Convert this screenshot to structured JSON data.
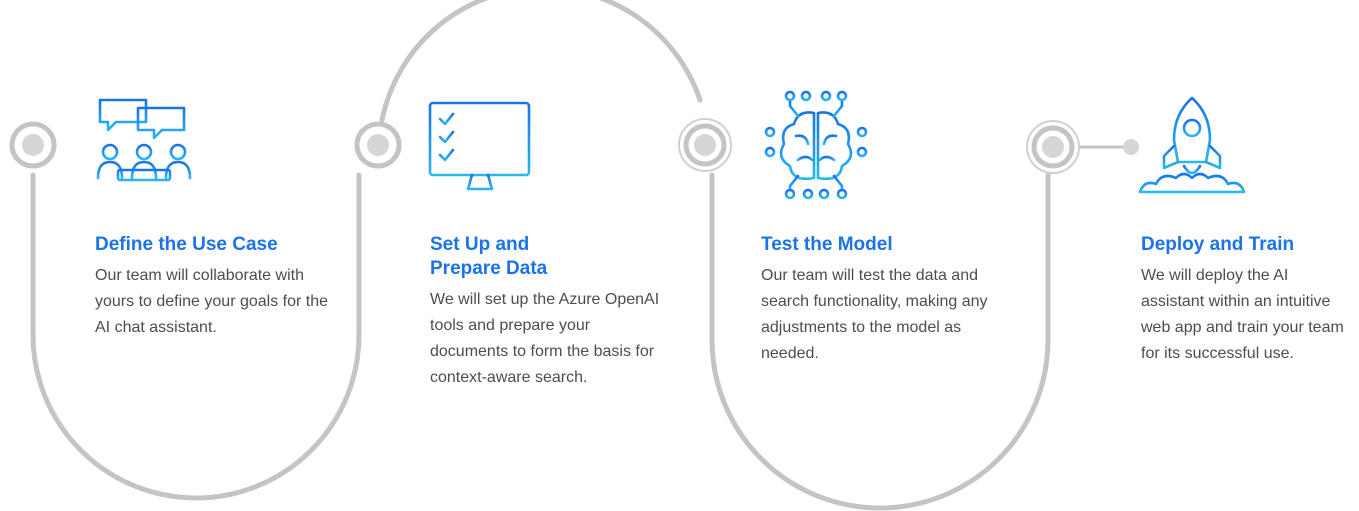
{
  "colors": {
    "accent": "#1a73e8",
    "accent_light": "#29b6f6",
    "track": "#c4c4c4",
    "node_fill": "#d6d6d6",
    "body_text": "#4d4d4d"
  },
  "steps": [
    {
      "title": "Define the Use Case",
      "description": "Our team will collaborate with yours to define your goals for the AI chat assistant.",
      "icon": "team-chat-icon"
    },
    {
      "title": "Set Up and Prepare Data",
      "description": "We will set up the Azure OpenAI tools and prepare your documents to form the basis for context-aware search.",
      "icon": "checklist-monitor-icon"
    },
    {
      "title": "Test the Model",
      "description": "Our team will test the data and search functionality, making any adjustments to the model as needed.",
      "icon": "ai-brain-icon"
    },
    {
      "title": "Deploy and Train",
      "description": "We will deploy the AI assistant within an intuitive web app and train your team for its successful use.",
      "icon": "rocket-launch-icon"
    }
  ]
}
